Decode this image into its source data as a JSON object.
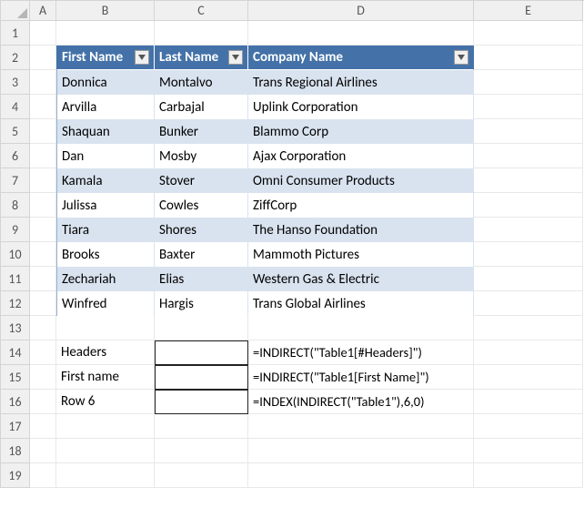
{
  "columns": [
    "A",
    "B",
    "C",
    "D",
    "E"
  ],
  "row_count": 19,
  "table": {
    "headers": [
      "First Name",
      "Last Name",
      "Company Name"
    ],
    "rows": [
      [
        "Donnica",
        "Montalvo",
        "Trans Regional Airlines"
      ],
      [
        "Arvilla",
        "Carbajal",
        "Uplink Corporation"
      ],
      [
        "Shaquan",
        "Bunker",
        "Blammo Corp"
      ],
      [
        "Dan",
        "Mosby",
        "Ajax Corporation"
      ],
      [
        "Kamala",
        "Stover",
        "Omni Consumer Products"
      ],
      [
        "Julissa",
        "Cowles",
        "ZiffCorp"
      ],
      [
        "Tiara",
        "Shores",
        "The Hanso Foundation"
      ],
      [
        "Brooks",
        "Baxter",
        "Mammoth Pictures"
      ],
      [
        "Zechariah",
        "Elias",
        "Western Gas & Electric"
      ],
      [
        "Winfred",
        "Hargis",
        "Trans Global Airlines"
      ]
    ]
  },
  "labels": {
    "headers": "Headers",
    "first_name": "First name",
    "row6": "Row 6"
  },
  "formulas": {
    "headers": "=INDIRECT(\"Table1[#Headers]\")",
    "first_name": "=INDIRECT(\"Table1[First Name]\")",
    "row6": "=INDEX(INDIRECT(\"Table1\"),6,0)"
  },
  "chart_data": {
    "type": "table",
    "title": "",
    "columns": [
      "First Name",
      "Last Name",
      "Company Name"
    ],
    "rows": [
      [
        "Donnica",
        "Montalvo",
        "Trans Regional Airlines"
      ],
      [
        "Arvilla",
        "Carbajal",
        "Uplink Corporation"
      ],
      [
        "Shaquan",
        "Bunker",
        "Blammo Corp"
      ],
      [
        "Dan",
        "Mosby",
        "Ajax Corporation"
      ],
      [
        "Kamala",
        "Stover",
        "Omni Consumer Products"
      ],
      [
        "Julissa",
        "Cowles",
        "ZiffCorp"
      ],
      [
        "Tiara",
        "Shores",
        "The Hanso Foundation"
      ],
      [
        "Brooks",
        "Baxter",
        "Mammoth Pictures"
      ],
      [
        "Zechariah",
        "Elias",
        "Western Gas & Electric"
      ],
      [
        "Winfred",
        "Hargis",
        "Trans Global Airlines"
      ]
    ]
  }
}
